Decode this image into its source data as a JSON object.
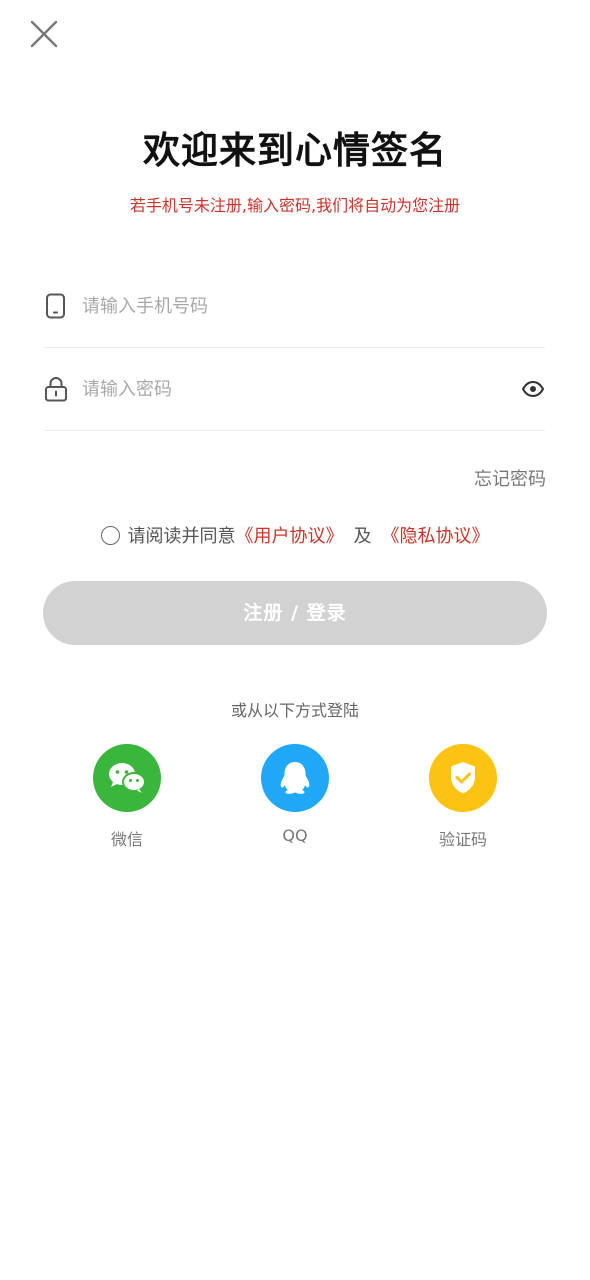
{
  "header": {
    "title": "欢迎来到心情签名",
    "subtitle": "若手机号未注册,输入密码,我们将自动为您注册"
  },
  "form": {
    "phone_placeholder": "请输入手机号码",
    "password_placeholder": "请输入密码",
    "forgot_label": "忘记密码"
  },
  "agreement": {
    "prefix": "请阅读并同意",
    "user_agreement": "《用户协议》",
    "and": "及",
    "privacy_policy": "《隐私协议》"
  },
  "login_button": {
    "label": "注册 / 登录"
  },
  "other_login": {
    "title": "或从以下方式登陆",
    "options": [
      {
        "label": "微信",
        "icon": "wechat-icon",
        "color": "#3bb63d"
      },
      {
        "label": "QQ",
        "icon": "qq-icon",
        "color": "#20a7f5"
      },
      {
        "label": "验证码",
        "icon": "shield-check-icon",
        "color": "#fcc313"
      }
    ]
  },
  "colors": {
    "accent_red": "#c9352b",
    "button_disabled": "#d2d2d2"
  }
}
